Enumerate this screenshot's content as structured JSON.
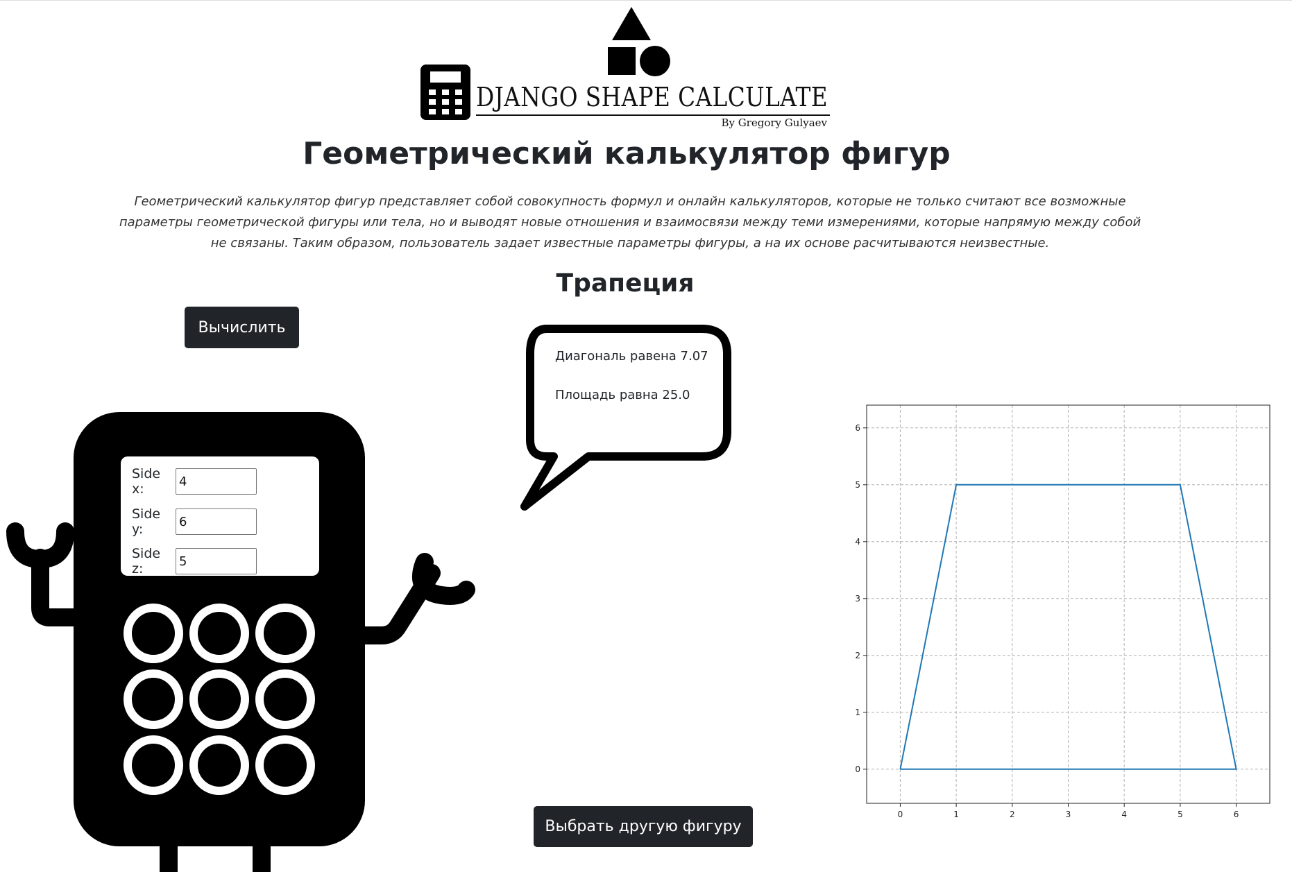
{
  "logo": {
    "title": "DJANGO SHAPE CALCULATE",
    "author": "By Gregory Gulyaev"
  },
  "page": {
    "title": "Геометрический калькулятор фигур",
    "intro": "Геометрический калькулятор фигур представляет собой совокупность формул и онлайн калькуляторов, которые не только считают все возможные параметры геометрической фигуры или тела, но и выводят новые отношения и взаимосвязи между теми измерениями, которые напрямую между собой не связаны. Таким образом, пользователь задает известные параметры фигуры, а на их основе расчитываются неизвестные.",
    "shape_title": "Трапеция"
  },
  "buttons": {
    "calculate": "Вычислить",
    "choose_other": "Выбрать другую фигуру"
  },
  "result": {
    "diagonal": "Диагональ равена 7.07",
    "area": "Площадь равна 25.0"
  },
  "form": {
    "side_x": {
      "label": "Side x:",
      "value": "4"
    },
    "side_y": {
      "label": "Side y:",
      "value": "6"
    },
    "side_z": {
      "label": "Side z:",
      "value": "5"
    }
  },
  "chart_data": {
    "type": "line",
    "title": "",
    "xlabel": "",
    "ylabel": "",
    "xlim": [
      -0.6,
      6.6
    ],
    "ylim": [
      -0.6,
      6.4
    ],
    "xticks": [
      0,
      1,
      2,
      3,
      4,
      5,
      6
    ],
    "yticks": [
      0,
      1,
      2,
      3,
      4,
      5,
      6
    ],
    "grid": true,
    "series": [
      {
        "color": "#1f77b4",
        "x": [
          0,
          1,
          5,
          6,
          0
        ],
        "y": [
          0,
          5,
          5,
          0,
          0
        ]
      }
    ]
  }
}
